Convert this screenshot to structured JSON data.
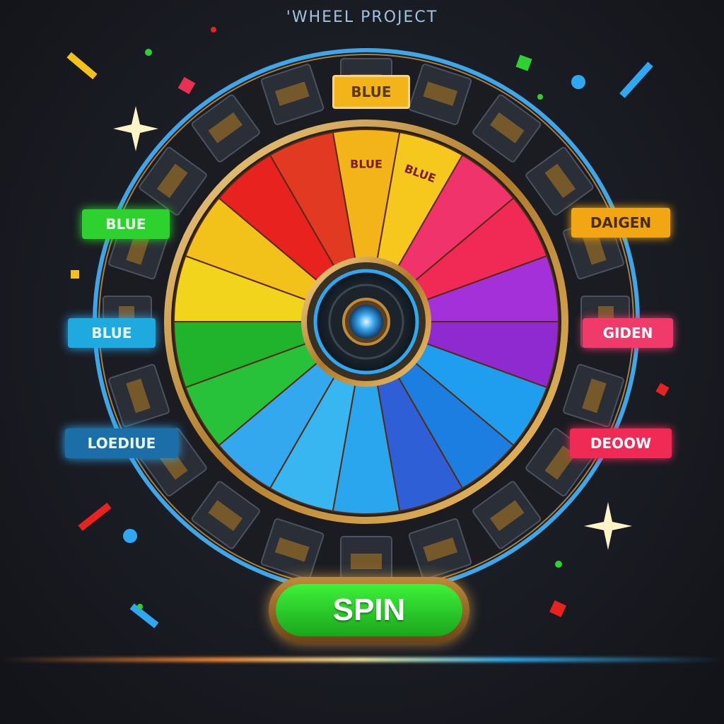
{
  "header": {
    "title": "'WHEEL PROJECT"
  },
  "wheel": {
    "segments": [
      {
        "label": "BLUE",
        "color": "#f2b418"
      },
      {
        "label": "BLUE",
        "color": "#f6c81e"
      },
      {
        "label": "",
        "color": "#f0336a"
      },
      {
        "label": "",
        "color": "#f02a55"
      },
      {
        "label": "",
        "color": "#a330d8"
      },
      {
        "label": "",
        "color": "#8f2ad0"
      },
      {
        "label": "",
        "color": "#1f9ef0"
      },
      {
        "label": "",
        "color": "#1c7ee0"
      },
      {
        "label": "",
        "color": "#2e5fd6"
      },
      {
        "label": "",
        "color": "#2aa6ee"
      },
      {
        "label": "",
        "color": "#38b6f2"
      },
      {
        "label": "",
        "color": "#34a8ee"
      },
      {
        "label": "",
        "color": "#27c23a"
      },
      {
        "label": "",
        "color": "#1fb42c"
      },
      {
        "label": "",
        "color": "#f2d41c"
      },
      {
        "label": "",
        "color": "#f2c21a"
      },
      {
        "label": "",
        "color": "#e8231f"
      },
      {
        "label": "",
        "color": "#e23a22"
      }
    ],
    "segment_count": 18
  },
  "side_tags": {
    "top": "BLUE",
    "left_1": "BLUE",
    "left_2": "BLUE",
    "left_3": "LOEDIUE",
    "right_1": "DAIGEN",
    "right_2": "GIDEN",
    "right_3": "DEOOW"
  },
  "spin_button": {
    "label": "SPIN"
  },
  "colors": {
    "gold": "#d7a548",
    "spin_green": "#2ed22f",
    "hub_blue": "#2ea8f0"
  }
}
